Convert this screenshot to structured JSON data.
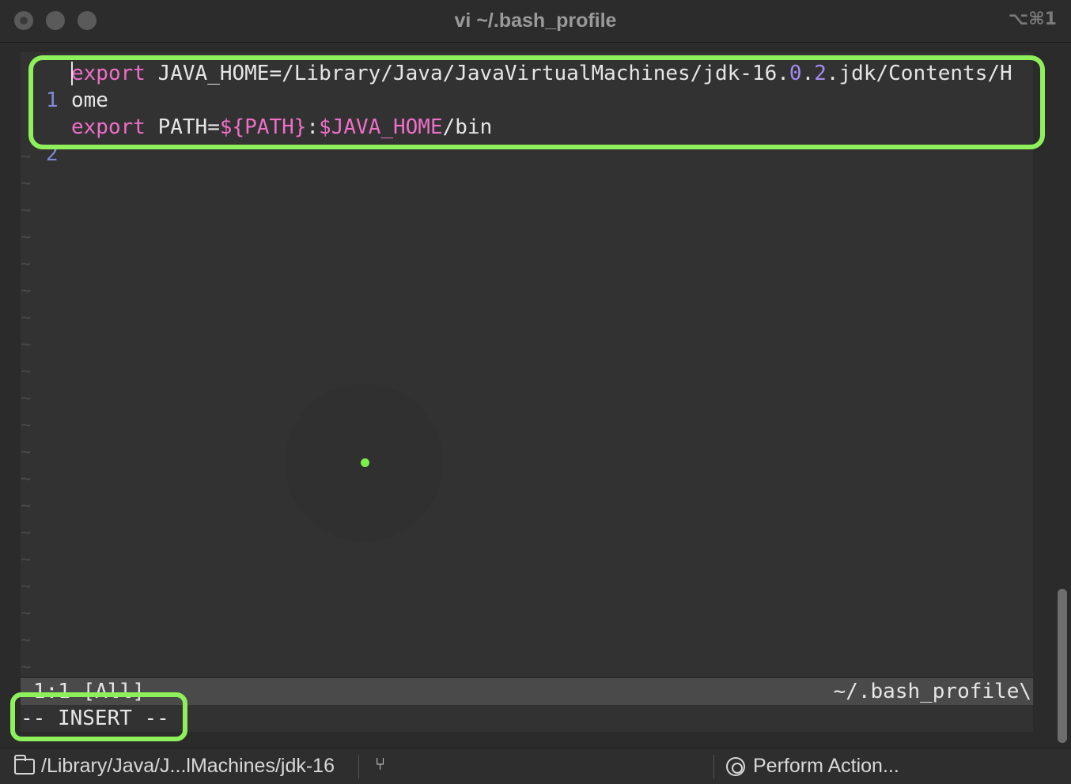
{
  "window": {
    "title": "vi ~/.bash_profile",
    "shortcut": "⌥⌘1"
  },
  "editor": {
    "lines": [
      {
        "number": "1",
        "kw": "export",
        "rest_a": " JAVA_HOME=/Library/Java/JavaVirtualMachines/jdk-16.",
        "num1": "0",
        "dot": ".",
        "num2": "2",
        "rest_b": ".jdk/Contents/H",
        "wrap": "ome"
      },
      {
        "number": "2",
        "kw": "export",
        "plain1": " PATH=",
        "var1": "${PATH}",
        "plain2": ":",
        "var2": "$JAVA_HOME",
        "plain3": "/bin"
      }
    ],
    "tilde": "~"
  },
  "statusline": {
    "position": "1:1 [All]",
    "filename": "~/.bash_profile\\"
  },
  "mode": "-- INSERT --",
  "bottombar": {
    "path": "/Library/Java/J...lMachines/jdk-16",
    "branch_icon": "⑂",
    "action": "Perform Action..."
  },
  "colors": {
    "highlight": "#8ef05a",
    "keyword": "#ee6fc8",
    "number": "#a58bf0",
    "line_number": "#7e8bd0"
  }
}
